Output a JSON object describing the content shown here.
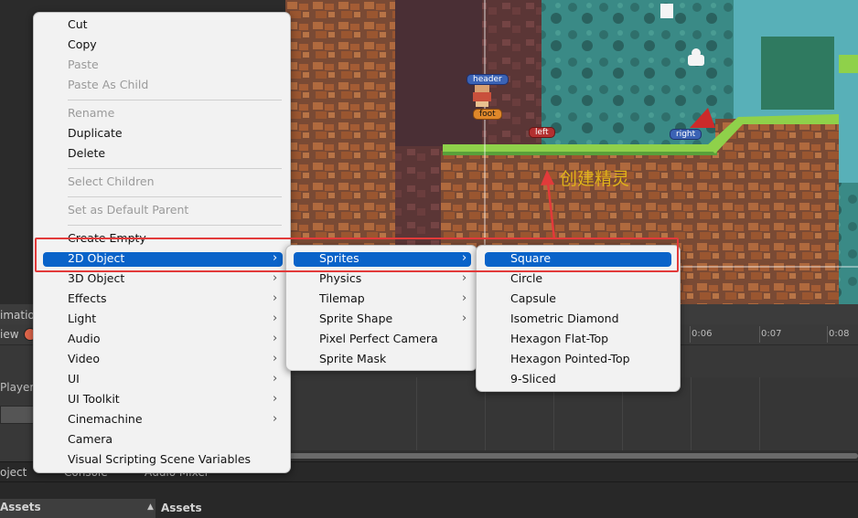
{
  "scene_labels": {
    "header": "header",
    "foot": "foot",
    "left": "left",
    "right": "right"
  },
  "annotation": "创建精灵",
  "animation": {
    "title": "imation",
    "preview": "iew",
    "player_label": "Player :",
    "ticks": [
      "0:06",
      "0:07",
      "0:08"
    ]
  },
  "bottom_tabs": {
    "project": "oject",
    "console": "Console",
    "audio_mixer": "Audio Mixer"
  },
  "assets": {
    "left_title": "Assets",
    "right_title": "Assets"
  },
  "context_menu": {
    "cut": "Cut",
    "copy": "Copy",
    "paste": "Paste",
    "paste_as_child": "Paste As Child",
    "rename": "Rename",
    "duplicate": "Duplicate",
    "delete": "Delete",
    "select_children": "Select Children",
    "set_default_parent": "Set as Default Parent",
    "create_empty": "Create Empty",
    "object_2d": "2D Object",
    "object_3d": "3D Object",
    "effects": "Effects",
    "light": "Light",
    "audio": "Audio",
    "video": "Video",
    "ui": "UI",
    "ui_toolkit": "UI Toolkit",
    "cinemachine": "Cinemachine",
    "camera": "Camera",
    "visual_scripting": "Visual Scripting Scene Variables"
  },
  "submenu_2d": {
    "sprites": "Sprites",
    "physics": "Physics",
    "tilemap": "Tilemap",
    "sprite_shape": "Sprite Shape",
    "pixel_perfect_camera": "Pixel Perfect Camera",
    "sprite_mask": "Sprite Mask"
  },
  "submenu_sprites": {
    "square": "Square",
    "circle": "Circle",
    "capsule": "Capsule",
    "isometric_diamond": "Isometric Diamond",
    "hexagon_flat_top": "Hexagon Flat-Top",
    "hexagon_pointed_top": "Hexagon Pointed-Top",
    "nine_sliced": "9-Sliced"
  },
  "colors": {
    "highlight": "#0a63c9",
    "annotation": "#e0b318",
    "callout": "#e23a3a"
  },
  "arrow_glyph": "›"
}
